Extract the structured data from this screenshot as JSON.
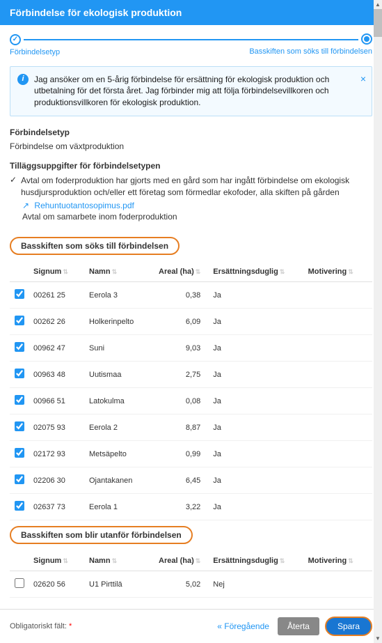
{
  "header": {
    "title": "Förbindelse för ekologisk produktion"
  },
  "stepper": {
    "step1": "Förbindelsetyp",
    "step2": "Basskiften som söks till förbindelsen"
  },
  "info": {
    "text": "Jag ansöker om en 5-årig förbindelse för ersättning för ekologisk produktion och utbetalning för det första året. Jag förbinder mig att följa förbindelsevillkoren och produktionsvillkoren för ekologisk produktion."
  },
  "type": {
    "heading": "Förbindelsetyp",
    "value": "Förbindelse om växtproduktion"
  },
  "extra": {
    "heading": "Tilläggsuppgifter för förbindelsetypen",
    "item1": "Avtal om foderproduktion har gjorts med en gård som har ingått förbindelse om ekologisk husdjursproduktion och/eller ett företag som förmedlar ekofoder, alla skiften på gården",
    "link": "Rehuntuotantosopimus.pdf",
    "item2": "Avtal om samarbete inom foderproduktion"
  },
  "section1": {
    "heading": "Basskiften som söks till förbindelsen"
  },
  "section2": {
    "heading": "Basskiften som blir utanför förbindelsen"
  },
  "columns": {
    "signum": "Signum",
    "namn": "Namn",
    "areal": "Areal (ha)",
    "ersattning": "Ersättningsduglig",
    "motivering": "Motivering"
  },
  "rows_in": [
    {
      "checked": true,
      "signum": "00261 25",
      "namn": "Eerola 3",
      "areal": "0,38",
      "ers": "Ja"
    },
    {
      "checked": true,
      "signum": "00262 26",
      "namn": "Holkerinpelto",
      "areal": "6,09",
      "ers": "Ja"
    },
    {
      "checked": true,
      "signum": "00962 47",
      "namn": "Suni",
      "areal": "9,03",
      "ers": "Ja"
    },
    {
      "checked": true,
      "signum": "00963 48",
      "namn": "Uutismaa",
      "areal": "2,75",
      "ers": "Ja"
    },
    {
      "checked": true,
      "signum": "00966 51",
      "namn": "Latokulma",
      "areal": "0,08",
      "ers": "Ja"
    },
    {
      "checked": true,
      "signum": "02075 93",
      "namn": "Eerola 2",
      "areal": "8,87",
      "ers": "Ja"
    },
    {
      "checked": true,
      "signum": "02172 93",
      "namn": "Metsäpelto",
      "areal": "0,99",
      "ers": "Ja"
    },
    {
      "checked": true,
      "signum": "02206 30",
      "namn": "Ojantakanen",
      "areal": "6,45",
      "ers": "Ja"
    },
    {
      "checked": true,
      "signum": "02637 73",
      "namn": "Eerola 1",
      "areal": "3,22",
      "ers": "Ja"
    }
  ],
  "rows_out": [
    {
      "checked": false,
      "signum": "02620 56",
      "namn": "U1 Pirttilä",
      "areal": "5,02",
      "ers": "Nej"
    }
  ],
  "footer": {
    "oblig": "Obligatoriskt fält:",
    "prev": "Föregående",
    "revert": "Återta",
    "save": "Spara"
  }
}
